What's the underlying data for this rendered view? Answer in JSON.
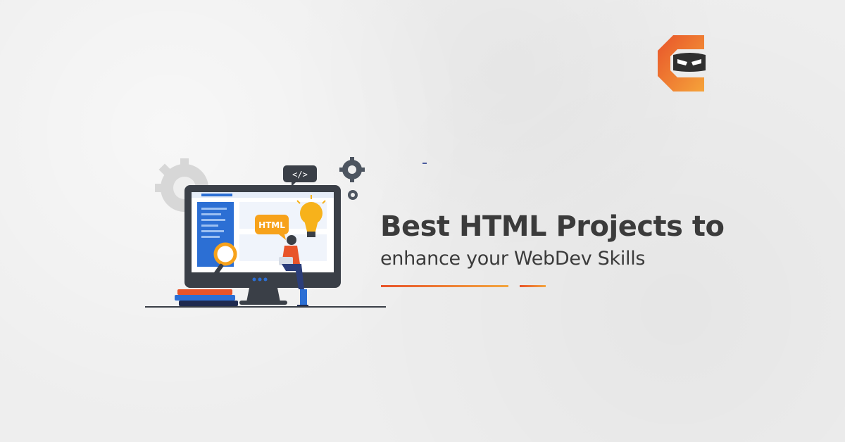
{
  "headline": "Best HTML Projects to",
  "subheadline": "enhance your WebDev Skills",
  "illustration": {
    "screen_badge": "HTML",
    "code_tag": "</>"
  },
  "brand": {
    "logo": "coding-ninjas-logo"
  },
  "colors": {
    "background": "#eeeeee",
    "text": "#3b3b3b",
    "accent_orange": "#e8542a",
    "accent_yellow": "#f3a640",
    "monitor_frame": "#3a3f47",
    "screen_blue": "#2c6fd4"
  }
}
